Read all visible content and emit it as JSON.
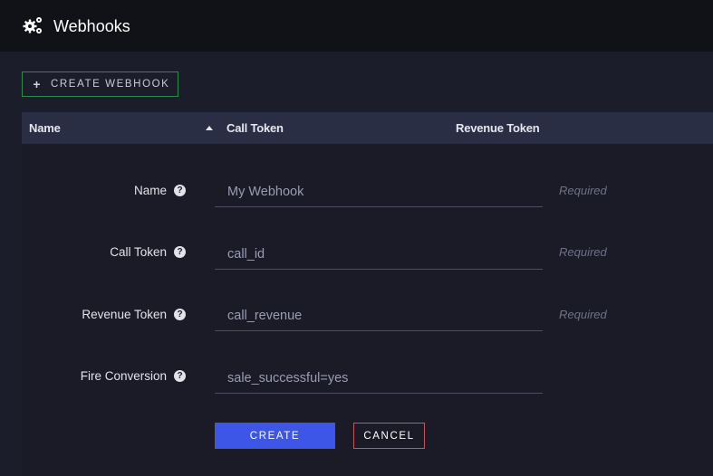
{
  "header": {
    "title": "Webhooks",
    "icon": "gears-icon"
  },
  "toolbar": {
    "create_webhook_label": "CREATE WEBHOOK",
    "create_webhook_icon": "plus-icon",
    "accent_color": "#2d8a4a"
  },
  "table": {
    "columns": [
      "Name",
      "Call Token",
      "Revenue Token"
    ],
    "sort_column": "Name",
    "sort_direction": "ascending"
  },
  "form": {
    "fields": [
      {
        "label": "Name",
        "value": "My Webhook",
        "hint": "Required"
      },
      {
        "label": "Call Token",
        "value": "call_id",
        "hint": "Required"
      },
      {
        "label": "Revenue Token",
        "value": "call_revenue",
        "hint": "Required"
      },
      {
        "label": "Fire Conversion",
        "value": "sale_successful=yes",
        "hint": ""
      }
    ],
    "help_glyph": "?",
    "create_label": "CREATE",
    "cancel_label": "CANCEL",
    "create_color": "#3d56e8",
    "cancel_border_color": "#c9545e"
  }
}
